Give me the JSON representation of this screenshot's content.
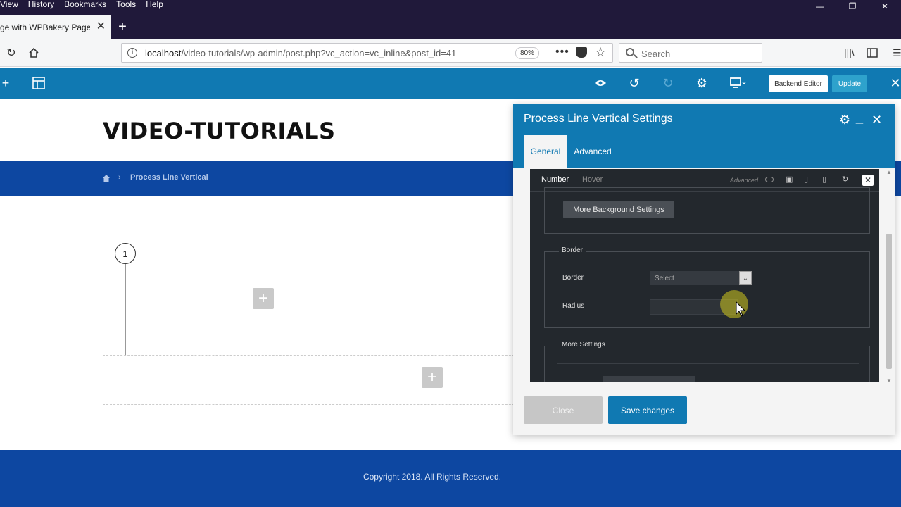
{
  "browser": {
    "menu": [
      {
        "underline": "",
        "rest": "View"
      },
      {
        "underline": "",
        "rest": "History"
      },
      {
        "underline": "B",
        "rest": "ookmarks"
      },
      {
        "underline": "T",
        "rest": "ools"
      },
      {
        "underline": "H",
        "rest": "elp"
      }
    ],
    "tab_title": "ge with WPBakery Page",
    "url_host": "localhost",
    "url_path": "/video-tutorials/wp-admin/post.php?vc_action=vc_inline&post_id=41",
    "zoom": "80%",
    "search_placeholder": "Search"
  },
  "vc_toolbar": {
    "backend_label": "Backend Editor",
    "update_label": "Update"
  },
  "page": {
    "site_title": "VIDEO-TUTORIALS",
    "breadcrumb_sep": "›",
    "breadcrumb_current": "Process Line Vertical",
    "process_number": "1",
    "add_glyph": "+",
    "footer_copyright": "Copyright 2018. All Rights Reserved."
  },
  "panel": {
    "title": "Process Line Vertical Settings",
    "tabs": [
      "General",
      "Advanced"
    ],
    "subtabs": [
      "Number",
      "Hover"
    ],
    "advanced_label": "Advanced",
    "more_bg_button": "More Background Settings",
    "border_group": "Border",
    "border_label": "Border",
    "border_select": "Select",
    "radius_label": "Radius",
    "more_settings_group": "More Settings",
    "close_button": "Close",
    "save_button": "Save changes"
  },
  "colors": {
    "toolbar_blue": "#1079b2",
    "site_blue": "#0d47a1",
    "browser_dark": "#20193a"
  }
}
